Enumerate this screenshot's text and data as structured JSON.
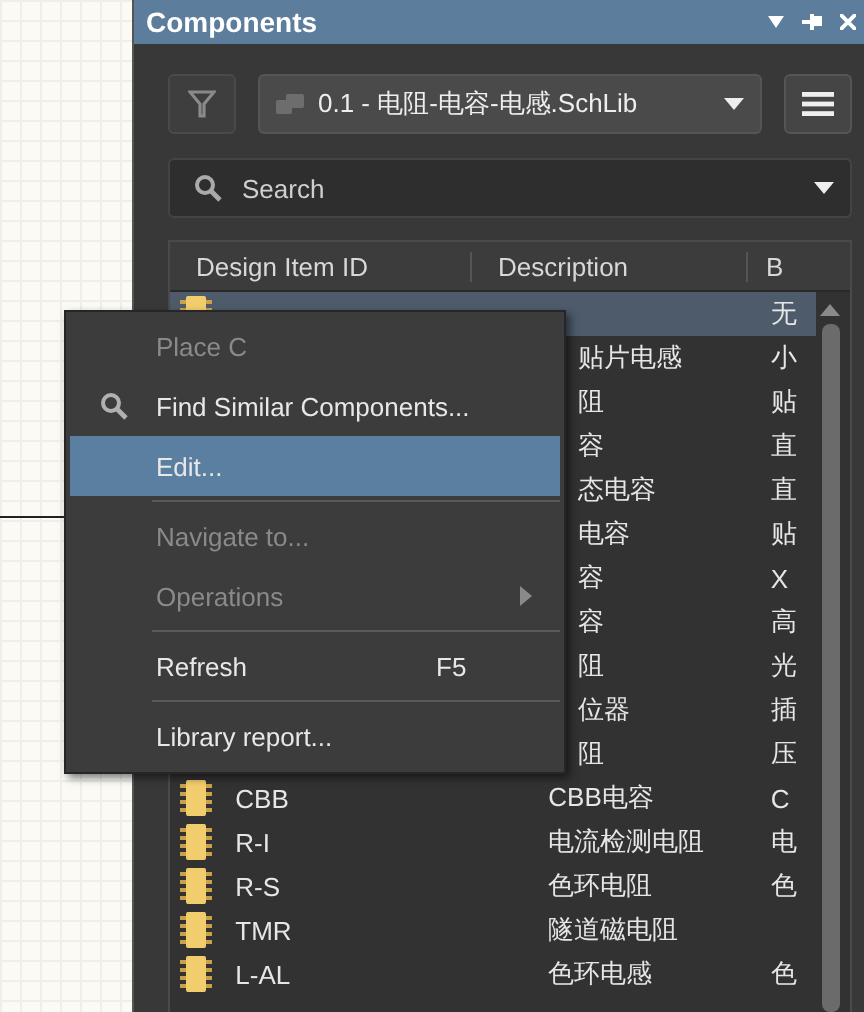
{
  "panel": {
    "title": "Components",
    "library": "0.1 - 电阻-电容-电感.SchLib",
    "search": {
      "placeholder": "Search"
    }
  },
  "table": {
    "columns": [
      "Design Item ID",
      "Description",
      "B"
    ],
    "rows": [
      {
        "kind": "top-covered",
        "selected": true,
        "id": "",
        "description": "",
        "column_3": "无"
      },
      {
        "kind": "covered",
        "selected": false,
        "id": "",
        "description": "贴片电感",
        "column_3": "小"
      },
      {
        "kind": "covered",
        "selected": false,
        "id": "",
        "description": "阻",
        "column_3": "贴"
      },
      {
        "kind": "covered",
        "selected": false,
        "id": "",
        "description": "容",
        "column_3": "直"
      },
      {
        "kind": "covered",
        "selected": false,
        "id": "",
        "description": "态电容",
        "column_3": "直"
      },
      {
        "kind": "covered",
        "selected": false,
        "id": "",
        "description": "电容",
        "column_3": "贴"
      },
      {
        "kind": "covered",
        "selected": false,
        "id": "",
        "description": "容",
        "column_3": "X"
      },
      {
        "kind": "covered",
        "selected": false,
        "id": "",
        "description": "容",
        "column_3": "高"
      },
      {
        "kind": "covered",
        "selected": false,
        "id": "",
        "description": "阻",
        "column_3": "光"
      },
      {
        "kind": "covered",
        "selected": false,
        "id": "",
        "description": "位器",
        "column_3": "插"
      },
      {
        "kind": "covered",
        "selected": false,
        "id": "",
        "description": "阻",
        "column_3": "压"
      },
      {
        "kind": "full",
        "selected": false,
        "id": "CBB",
        "description": "CBB电容",
        "column_3": "C"
      },
      {
        "kind": "full",
        "selected": false,
        "id": "R-I",
        "description": "电流检测电阻",
        "column_3": "电"
      },
      {
        "kind": "full",
        "selected": false,
        "id": "R-S",
        "description": "色环电阻",
        "column_3": "色"
      },
      {
        "kind": "full",
        "selected": false,
        "id": "TMR",
        "description": "隧道磁电阻",
        "column_3": ""
      },
      {
        "kind": "full",
        "selected": false,
        "id": "L-AL",
        "description": "色环电感",
        "column_3": "色"
      }
    ]
  },
  "menu": {
    "items": [
      {
        "kind": "item",
        "label": "Place C",
        "disabled": true,
        "selected": false
      },
      {
        "kind": "search-item",
        "label": "Find Similar Components...",
        "disabled": false,
        "selected": false
      },
      {
        "kind": "item",
        "label": "Edit...",
        "disabled": false,
        "selected": true
      },
      {
        "kind": "separator"
      },
      {
        "kind": "item",
        "label": "Navigate to...",
        "disabled": true,
        "selected": false
      },
      {
        "kind": "submenu",
        "label": "Operations",
        "disabled": true,
        "selected": false
      },
      {
        "kind": "separator"
      },
      {
        "kind": "item",
        "label": "Refresh",
        "shortcut": "F5",
        "disabled": false,
        "selected": false
      },
      {
        "kind": "separator"
      },
      {
        "kind": "item",
        "label": "Library report...",
        "disabled": false,
        "selected": false
      }
    ]
  }
}
